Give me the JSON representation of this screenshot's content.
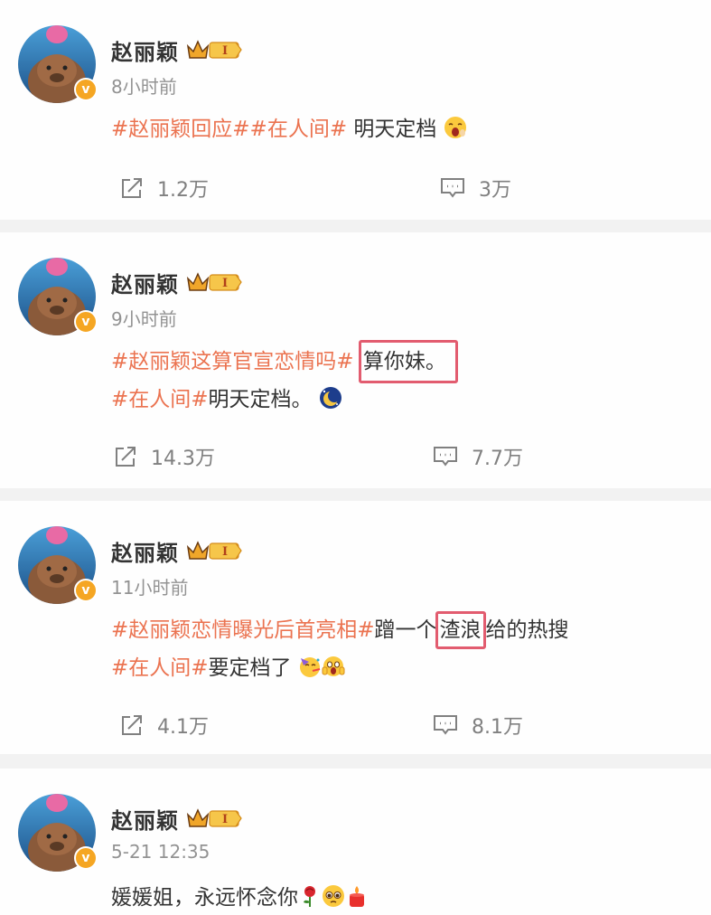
{
  "user": {
    "name": "赵丽颖",
    "badge_level": "I",
    "verified_mark": "v"
  },
  "posts": [
    {
      "time": "8小时前",
      "line1": {
        "tags": "#赵丽颖回应##在人间#",
        "text": " 明天定档"
      },
      "emoji1": "yawning-face-icon",
      "share": "1.2万",
      "comment": "3万"
    },
    {
      "time": "9小时前",
      "line1": {
        "tags": "#赵丽颖这算官宣恋情吗#",
        "highlight": "算你妹。"
      },
      "line2": {
        "tags": "#在人间#",
        "text": "明天定档。"
      },
      "emoji1": "moon-face-icon",
      "share": "14.3万",
      "comment": "7.7万"
    },
    {
      "time": "11小时前",
      "line1": {
        "tags": "#赵丽颖恋情曝光后首亮相#",
        "pre": "蹭一个",
        "highlight": "渣浪",
        "post": "给的热搜"
      },
      "line2": {
        "tags": "#在人间#",
        "text": "要定档了"
      },
      "emoji1": "party-face-icon",
      "emoji2": "screaming-face-icon",
      "share": "4.1万",
      "comment": "8.1万"
    },
    {
      "time": "5-21 12:35",
      "line1": {
        "text": "媛媛姐，永远怀念你"
      },
      "emoji1": "rose-icon",
      "emoji2": "pleading-face-icon",
      "emoji3": "candle-icon"
    }
  ],
  "colors": {
    "topic": "#eb7350",
    "highlight_box": "#e25c6f",
    "verified": "#f5a623"
  }
}
